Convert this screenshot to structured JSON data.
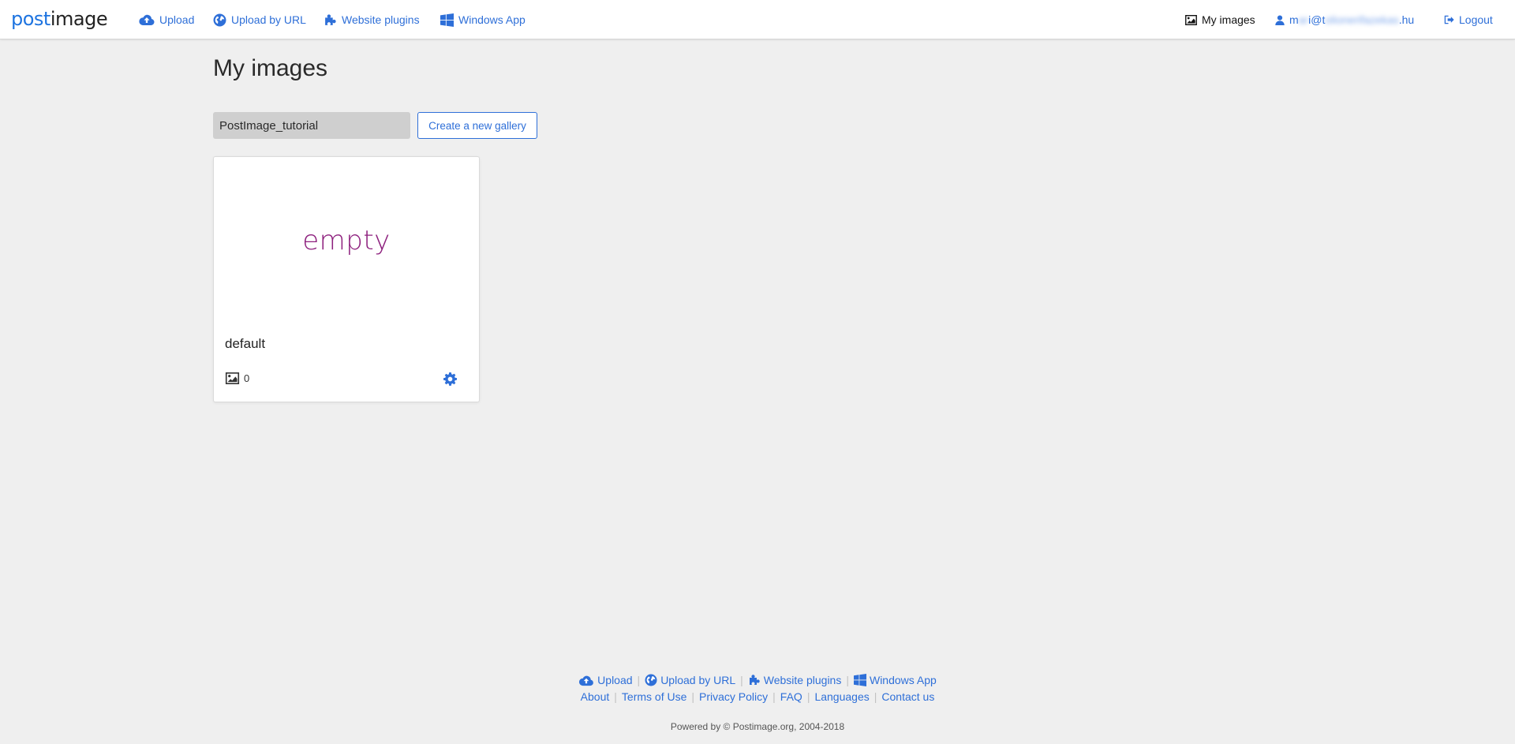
{
  "header": {
    "logo_post": "post",
    "logo_image": "image",
    "nav": {
      "upload": "Upload",
      "upload_by_url": "Upload by URL",
      "website_plugins": "Website plugins",
      "windows_app": "Windows App"
    },
    "my_images": "My images",
    "email_visible_start": "m",
    "email_blurred_1": "ar",
    "email_visible_mid": "i@t",
    "email_blurred_2": "olionerifazekas",
    "email_visible_end": ".hu",
    "logout": "Logout"
  },
  "main": {
    "title": "My images",
    "gallery_select_value": "PostImage_tutorial",
    "create_gallery": "Create a new gallery",
    "gallery": {
      "placeholder_text": "empty",
      "name": "default",
      "image_count": "0"
    }
  },
  "footer": {
    "links_row1": {
      "upload": "Upload",
      "upload_by_url": "Upload by URL",
      "website_plugins": "Website plugins",
      "windows_app": "Windows App"
    },
    "links_row2": {
      "about": "About",
      "terms": "Terms of Use",
      "privacy": "Privacy Policy",
      "faq": "FAQ",
      "languages": "Languages",
      "contact": "Contact us"
    },
    "separator": "|",
    "powered_by": "Powered by © Postimage.org, 2004-2018"
  },
  "icons": {
    "upload": "cloud-upload-icon",
    "upload_by_url": "globe-icon",
    "website_plugins": "puzzle-icon",
    "windows_app": "windows-icon",
    "my_images": "image-icon",
    "user": "user-icon",
    "logout": "sign-out-icon",
    "count": "image-icon",
    "settings": "gear-icon"
  },
  "colors": {
    "accent": "#2e6fd8",
    "empty_text": "#8d1f7d",
    "background": "#efefef"
  }
}
